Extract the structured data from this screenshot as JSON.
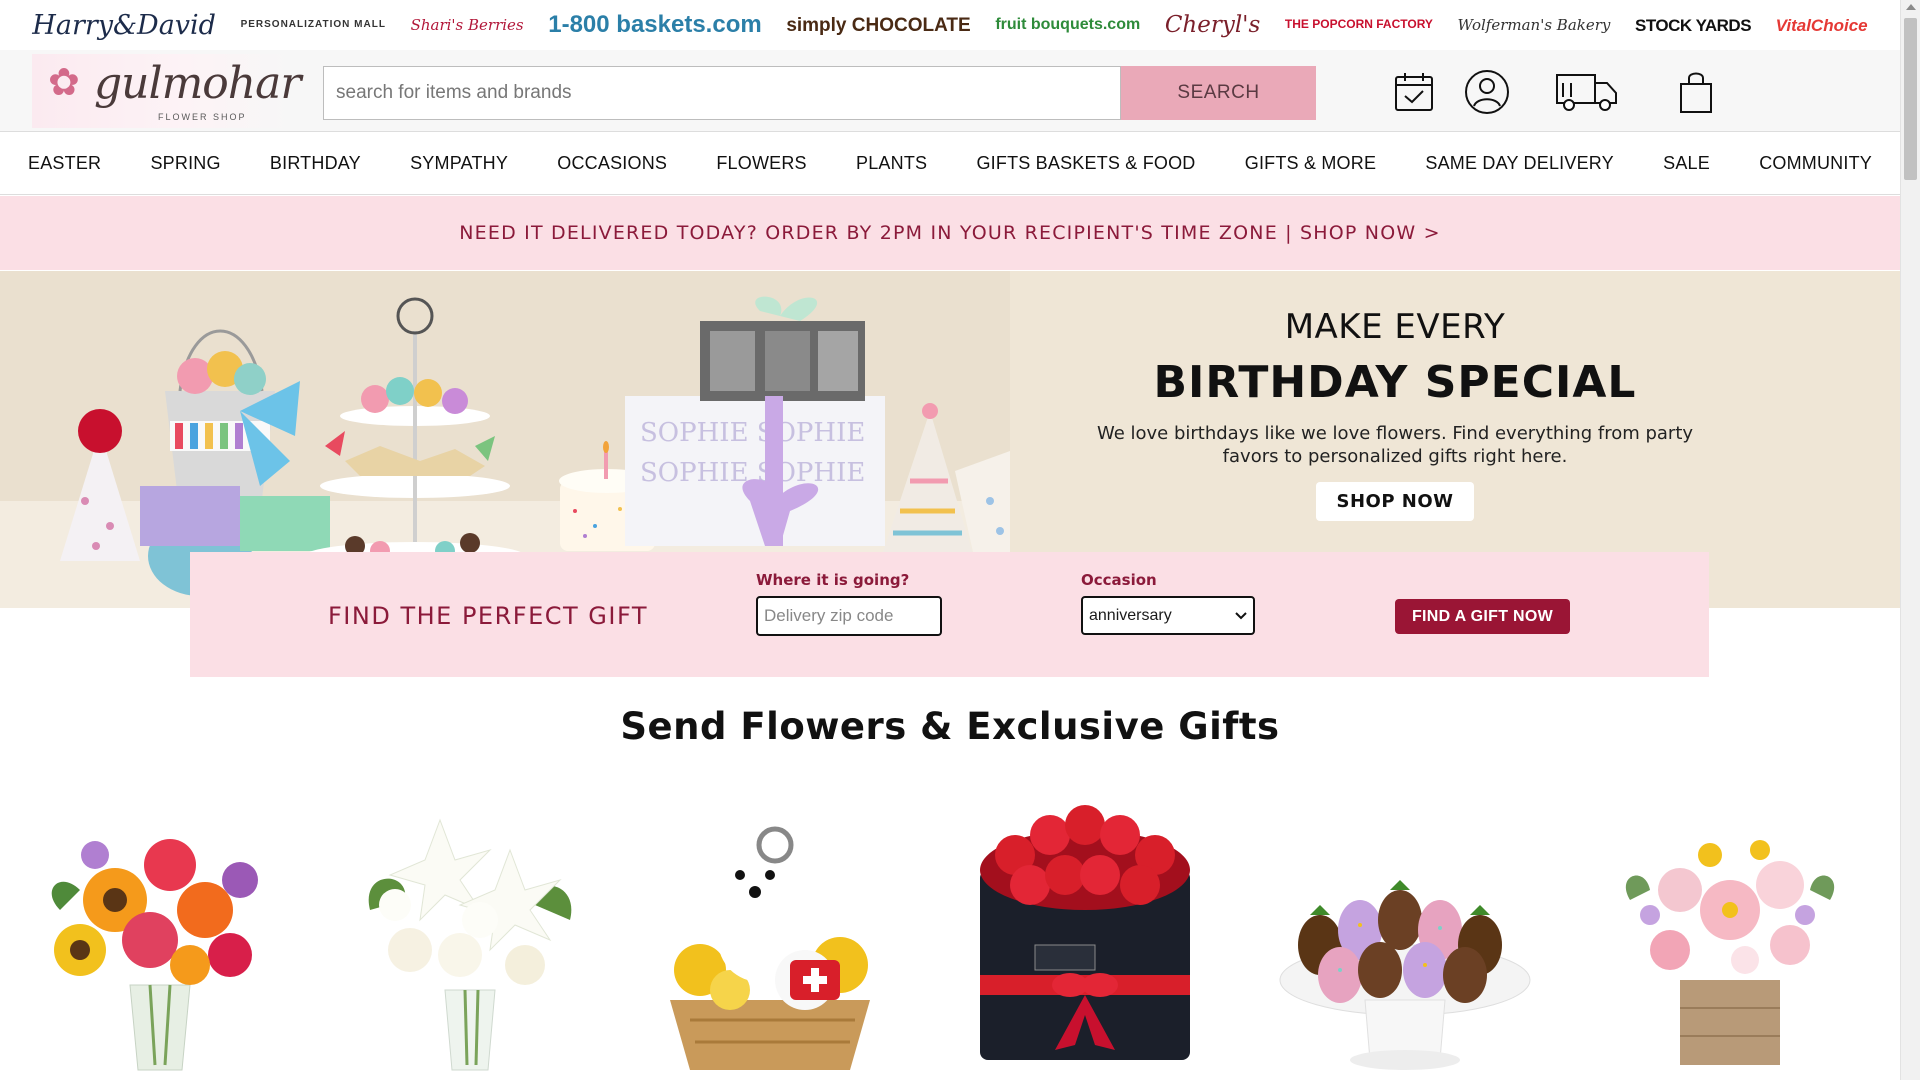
{
  "brands": [
    "Harry&David",
    "PERSONALIZATION MALL",
    "Shari's Berries",
    "1-800 baskets.com",
    "simply CHOCOLATE",
    "fruit bouquets.com",
    "Cheryl's",
    "THE POPCORN FACTORY",
    "Wolferman's Bakery",
    "STOCK YARDS",
    "VitalChoice"
  ],
  "header": {
    "logo_name": "gulmohar",
    "logo_sub": "FLOWER SHOP",
    "search_placeholder": "search for items and brands",
    "search_button": "SEARCH",
    "icons": [
      "calendar-check-icon",
      "account-icon",
      "delivery-truck-icon",
      "shopping-bag-icon"
    ]
  },
  "nav": [
    "EASTER",
    "SPRING",
    "BIRTHDAY",
    "SYMPATHY",
    "OCCASIONS",
    "FLOWERS",
    "PLANTS",
    "GIFTS BASKETS & FOOD",
    "GIFTS & MORE",
    "SAME DAY DELIVERY",
    "SALE",
    "COMMUNITY"
  ],
  "promo": {
    "text": "NEED IT DELIVERED TODAY? ORDER BY 2PM IN YOUR RECIPIENT'S TIME ZONE | SHOP NOW >"
  },
  "hero": {
    "title_line1": "MAKE EVERY",
    "title_line2": "BIRTHDAY SPECIAL",
    "body": "We love birthdays like we love flowers. Find everything from party favors to personalized gifts right here.",
    "cta": "SHOP NOW"
  },
  "gift_finder": {
    "title": "FIND THE PERFECT GIFT",
    "zip_label": "Where it is going?",
    "zip_placeholder": "Delivery zip code",
    "occasion_label": "Occasion",
    "occasion_value": "anniversary",
    "button": "FIND A GIFT NOW"
  },
  "section": {
    "title": "Send Flowers & Exclusive Gifts"
  },
  "colors": {
    "accent": "#8b1a3a",
    "pink_bar": "#fbdfe5",
    "search_button": "#eaa9b8",
    "button": "#9a1535",
    "hero_bg": "#efe6d6"
  }
}
